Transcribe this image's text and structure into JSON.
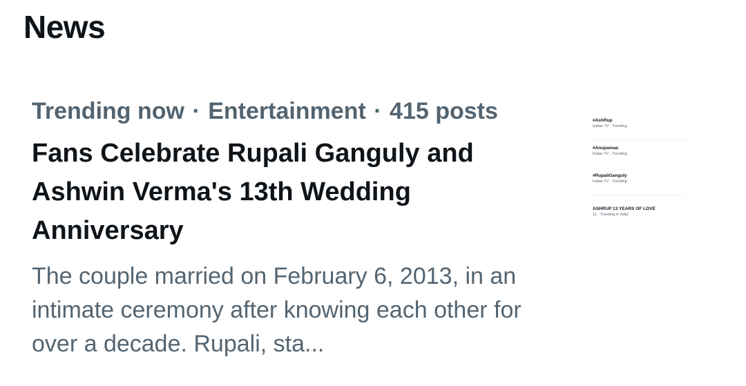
{
  "section": {
    "title": "News"
  },
  "story": {
    "category": "Trending now",
    "topic": "Entertainment",
    "posts": "415 posts",
    "separator": "·",
    "headline": "Fans Celebrate Rupali Ganguly and Ashwin Verma's 13th Wedding Anniversary",
    "summary": "The couple married on February 6, 2013, in an intimate ceremony after knowing each other for over a decade. Rupali, sta..."
  },
  "thumbnail": {
    "items": [
      {
        "tag": "#AshRup",
        "sub": "Indian TV · Trending"
      },
      {
        "tag": "#Anupamaa",
        "sub": "Indian TV · Trending"
      },
      {
        "tag": "#RupaliGanguly",
        "sub": "Indian TV · Trending"
      },
      {
        "tag": "ASHRUP 13 YEARS OF LOVE",
        "sub": "11 · Trending in India"
      }
    ]
  }
}
